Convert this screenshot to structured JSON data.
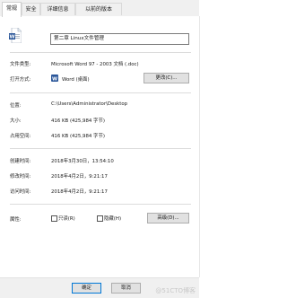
{
  "tabs": [
    {
      "label": "常规"
    },
    {
      "label": "安全"
    },
    {
      "label": "详细信息"
    },
    {
      "label": "以前的版本"
    }
  ],
  "file": {
    "name": "第二章 Linux文件管理"
  },
  "rows": {
    "file_type_label": "文件类型:",
    "file_type_value": "Microsoft Word 97 - 2003 文档 (.doc)",
    "open_with_label": "打开方式:",
    "open_with_value": "Word (桌面)",
    "change_button": "更改(C)...",
    "location_label": "位置:",
    "location_value": "C:\\Users\\Administrator\\Desktop",
    "size_label": "大小:",
    "size_value": "416 KB (425,984 字节)",
    "size_on_disk_label": "占用空间:",
    "size_on_disk_value": "416 KB (425,984 字节)",
    "created_label": "创建时间:",
    "created_value": "2018年3月30日，13:54:10",
    "modified_label": "修改时间:",
    "modified_value": "2018年4月2日，9:21:17",
    "accessed_label": "访问时间:",
    "accessed_value": "2018年4月2日，9:21:17",
    "attributes_label": "属性:",
    "readonly_label": "只读(R)",
    "hidden_label": "隐藏(H)",
    "advanced_button": "高级(D)..."
  },
  "footer": {
    "ok": "确定",
    "cancel": "取消",
    "watermark": "@51CTO博客"
  },
  "colors": {
    "word_blue": "#2b579a",
    "focus_blue": "#0078d7"
  }
}
